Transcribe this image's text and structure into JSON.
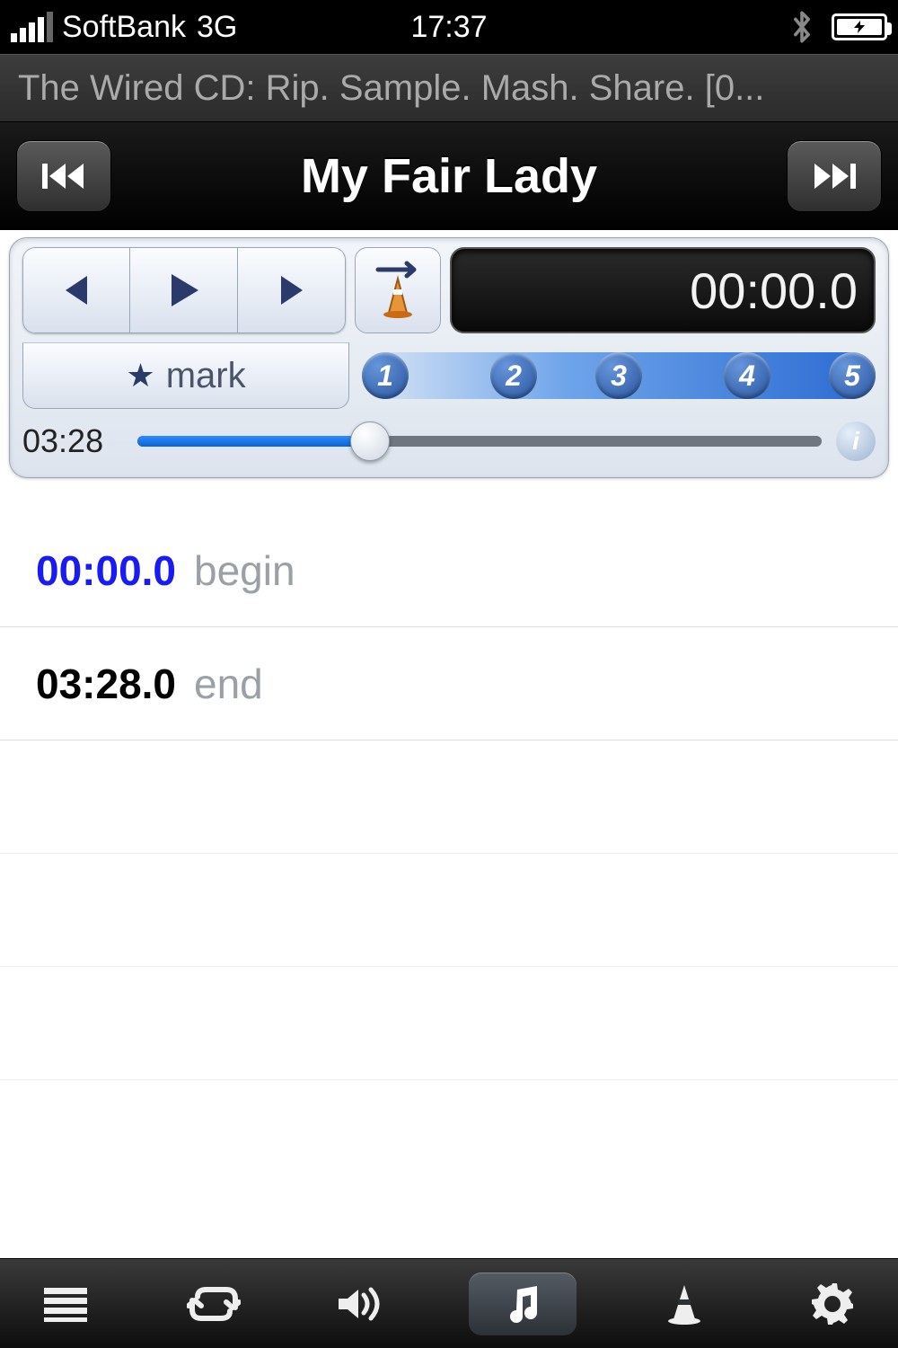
{
  "status": {
    "carrier": "SoftBank",
    "network": "3G",
    "time": "17:37"
  },
  "album": {
    "line": "The Wired CD: Rip. Sample. Mash. Share. [0..."
  },
  "track": {
    "title": "My Fair Lady"
  },
  "controls": {
    "timer": "00:00.0",
    "mark_label": "mark",
    "badges": {
      "b1": "1",
      "b2": "2",
      "b3": "3",
      "b4": "4",
      "b5": "5"
    },
    "elapsed": "03:28"
  },
  "markers": {
    "begin": {
      "time": "00:00.0",
      "label": "begin"
    },
    "end": {
      "time": "03:28.0",
      "label": "end"
    }
  }
}
